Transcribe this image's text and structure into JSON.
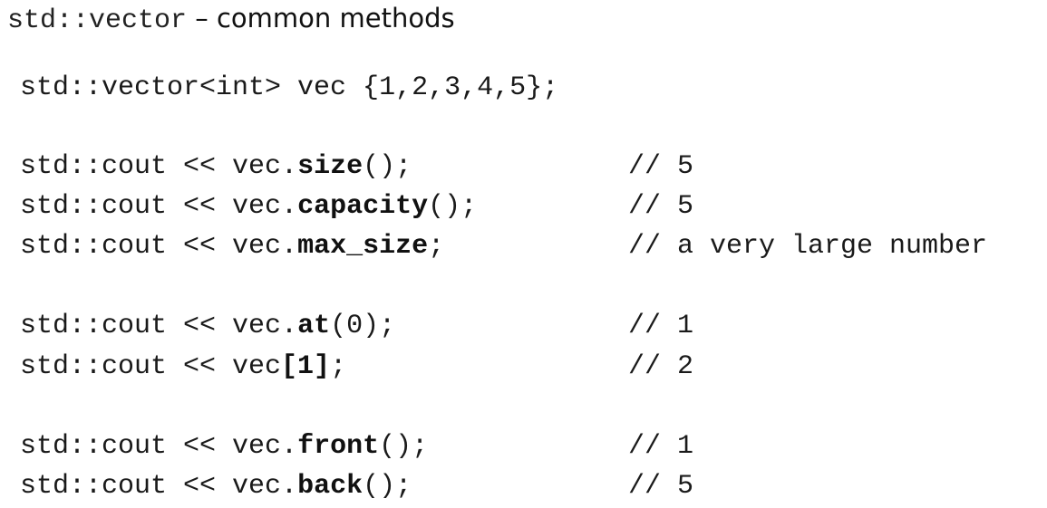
{
  "title": {
    "code": "std::vector",
    "text": " – common methods"
  },
  "declaration": "std::vector<int> vec {1,2,3,4,5};",
  "lines": [
    {
      "prefix": "std::cout << vec.",
      "method": "size",
      "suffix": "();",
      "comment": "// 5"
    },
    {
      "prefix": "std::cout << vec.",
      "method": "capacity",
      "suffix": "();",
      "comment": "// 5"
    },
    {
      "prefix": "std::cout << vec.",
      "method": "max_size",
      "suffix": ";",
      "comment": "// a very large number"
    },
    {
      "prefix": "std::cout << vec.",
      "method": "at",
      "suffix": "(0);",
      "comment": "// 1"
    },
    {
      "prefix": "std::cout << vec",
      "method": "[1]",
      "suffix": ";",
      "comment": "// 2"
    },
    {
      "prefix": "std::cout << vec.",
      "method": "front",
      "suffix": "();",
      "comment": "// 1"
    },
    {
      "prefix": "std::cout << vec.",
      "method": "back",
      "suffix": "();",
      "comment": "// 5"
    }
  ]
}
